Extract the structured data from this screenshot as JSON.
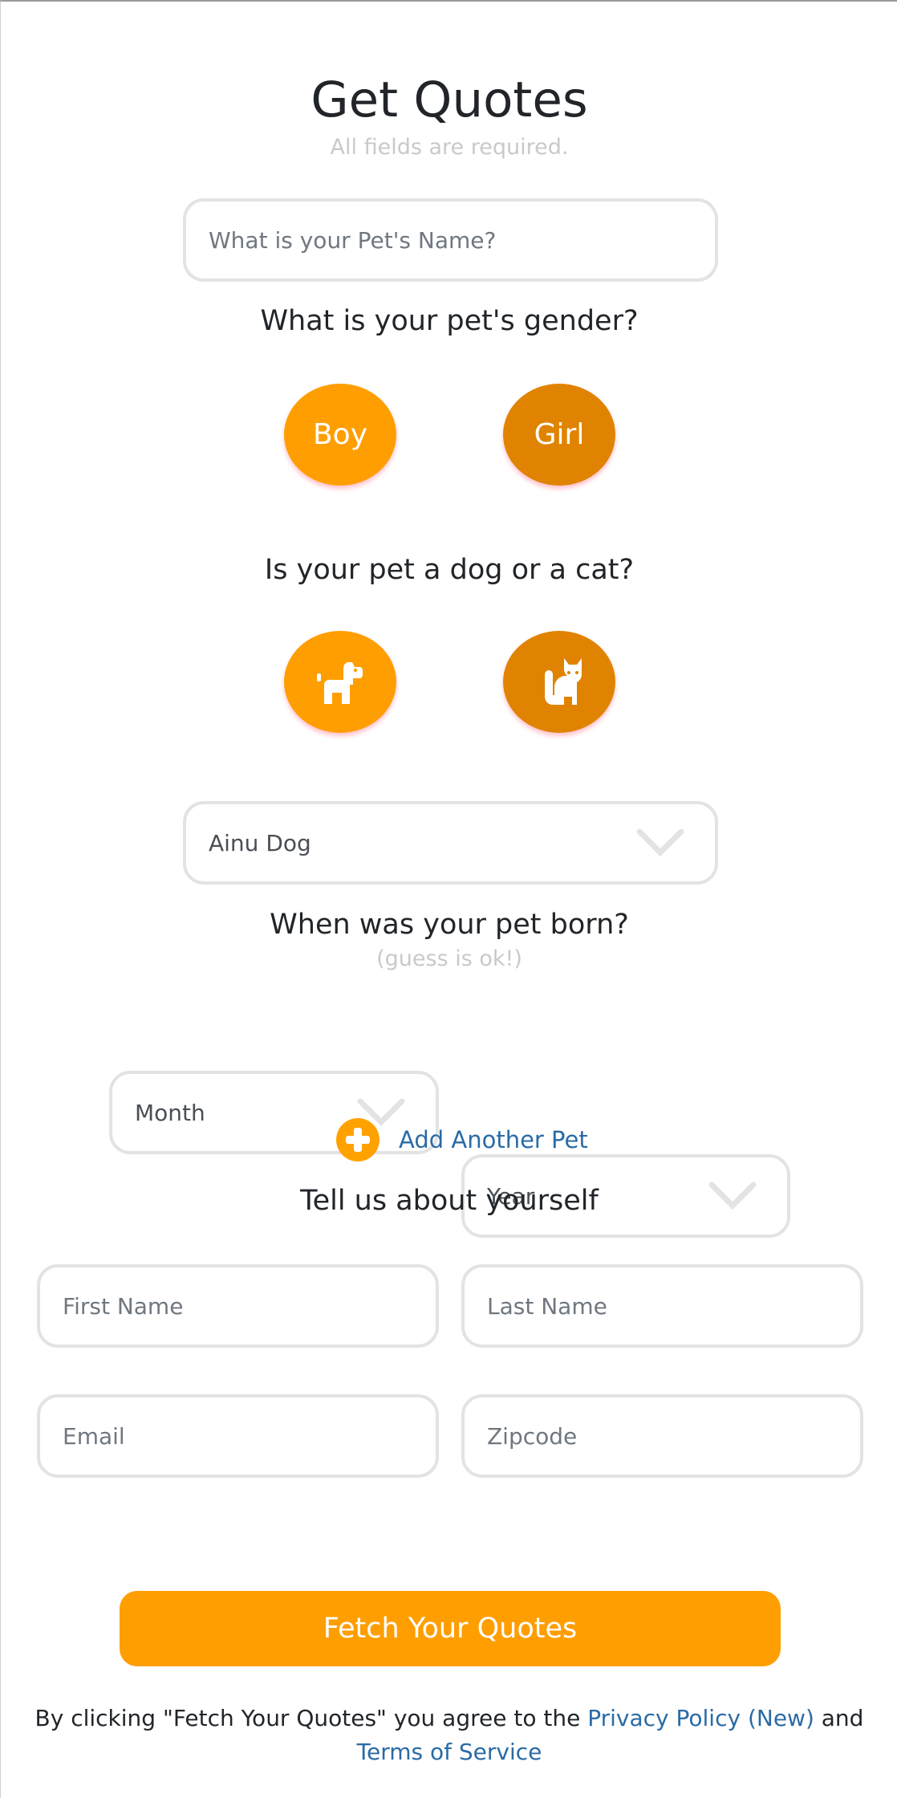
{
  "header": {
    "title": "Get Quotes",
    "subtitle": "All fields are required."
  },
  "pet": {
    "name_placeholder": "What is your Pet's Name?",
    "gender_question": "What is your pet's gender?",
    "gender_options": [
      "Boy",
      "Girl"
    ],
    "species_question": "Is your pet a dog or a cat?",
    "species_icons": [
      "dog-icon",
      "cat-icon"
    ],
    "breed_selected": "Ainu Dog",
    "birth_question": "When was your pet born?",
    "birth_hint": "(guess is ok!)",
    "month_selected": "Month",
    "year_selected": "Year",
    "add_another_label": "Add Another Pet"
  },
  "owner": {
    "heading": "Tell us about yourself",
    "first_name_placeholder": "First Name",
    "last_name_placeholder": "Last Name",
    "email_placeholder": "Email",
    "zipcode_placeholder": "Zipcode"
  },
  "submit": {
    "label": "Fetch Your Quotes"
  },
  "legal": {
    "prefix": "By clicking \"Fetch Your Quotes\" you agree to the ",
    "privacy_link": "Privacy Policy (New)",
    "conjunction": " and",
    "terms_link": "Terms of Service"
  },
  "colors": {
    "accent": "#ff9e00",
    "accent_dark": "#e08300",
    "link": "#2a6ba6",
    "border": "#e3e3e3"
  }
}
